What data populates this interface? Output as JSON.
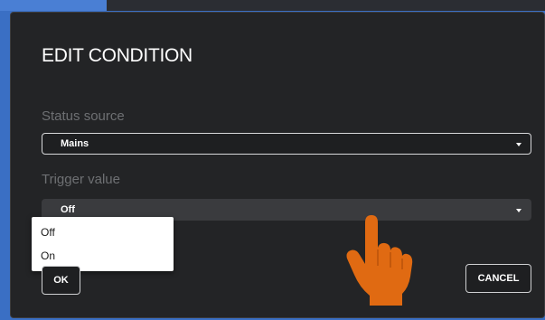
{
  "dialog": {
    "title": "EDIT CONDITION",
    "status_source": {
      "label": "Status source",
      "value": "Mains"
    },
    "trigger_value": {
      "label": "Trigger value",
      "value": "Off",
      "options": [
        "Off",
        "On"
      ]
    },
    "buttons": {
      "ok": "OK",
      "cancel": "CANCEL"
    }
  },
  "colors": {
    "backdrop": "#3a6fc4",
    "dialog_bg": "#232426",
    "label": "#6e7073",
    "hand": "#e06a12"
  },
  "icons": {
    "dropdown": "chevron-down-icon",
    "pointer": "pointing-hand-icon"
  }
}
